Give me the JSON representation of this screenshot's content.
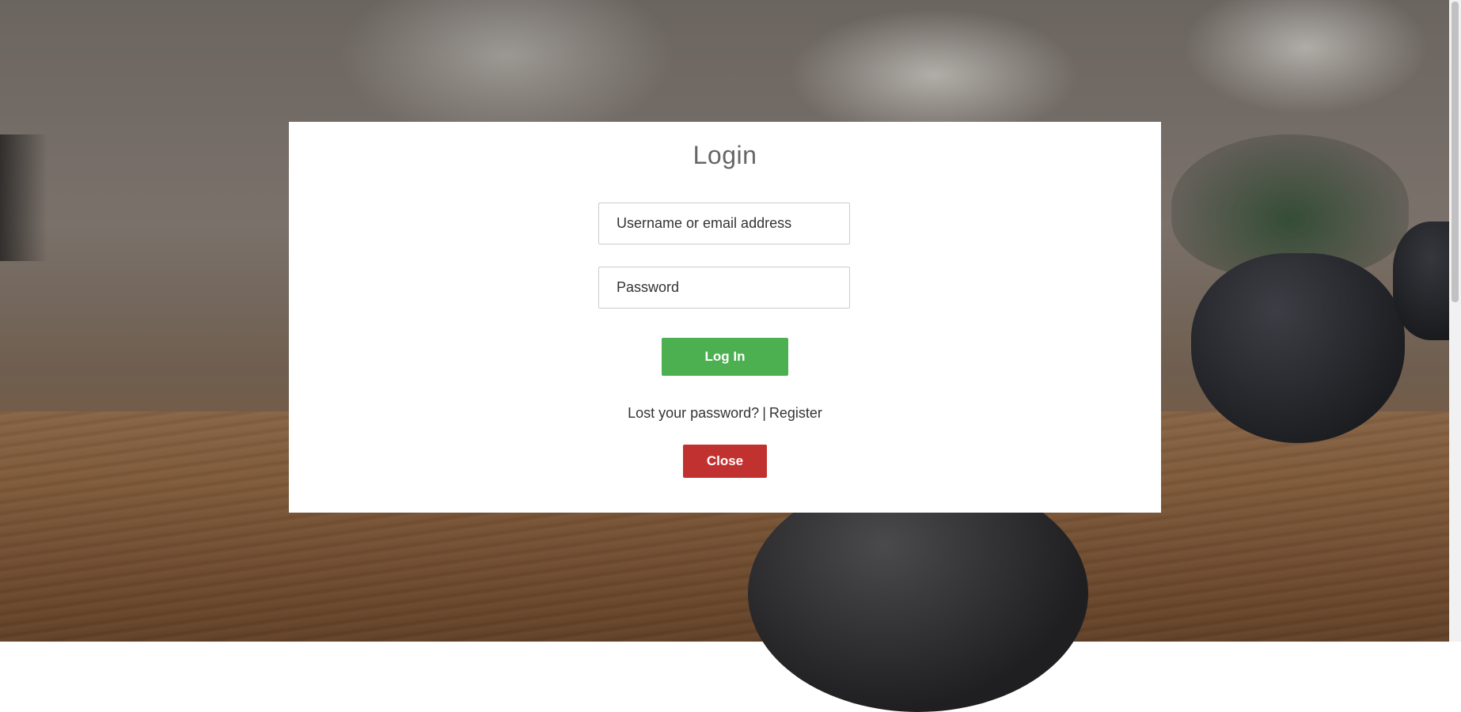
{
  "modal": {
    "title": "Login",
    "username_placeholder": "Username or email address",
    "password_placeholder": "Password",
    "login_button": "Log In",
    "lost_password_link": "Lost your password?",
    "separator": "|",
    "register_link": "Register",
    "close_button": "Close"
  },
  "colors": {
    "login_button": "#4caf50",
    "close_button": "#c0312f",
    "modal_background": "#ffffff"
  }
}
